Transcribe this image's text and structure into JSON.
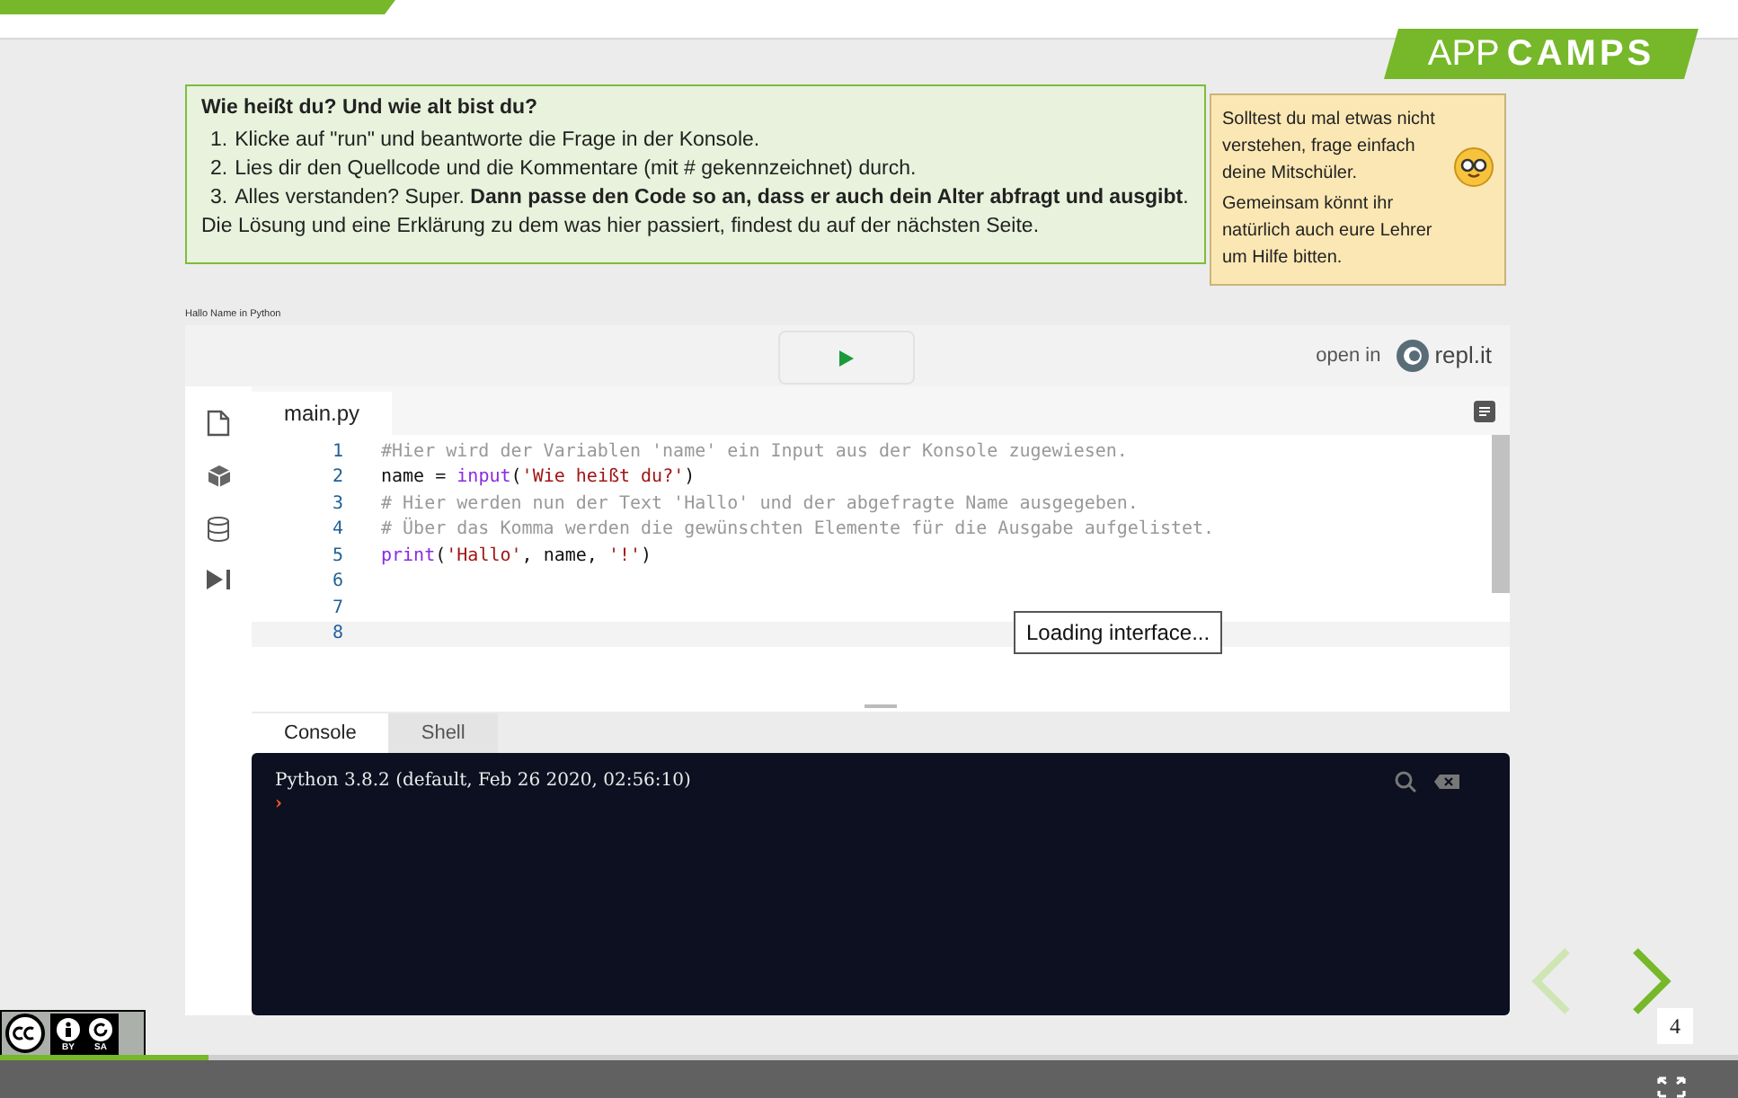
{
  "logo": {
    "word_1": "APP",
    "word_2": "CAMPS"
  },
  "instructions": {
    "title": "Wie heißt du? Und wie alt bist du?",
    "steps": [
      {
        "number": "1.",
        "text": "Klicke auf \"run\" und beantworte die Frage in der Konsole."
      },
      {
        "number": "2.",
        "text": "Lies dir den Quellcode und die Kommentare (mit # gekennzeichnet) durch."
      },
      {
        "number": "3.",
        "text": "Alles verstanden? Super. **Dann passe den Code so an, dass er auch dein Alter abfragt und ausgibt**."
      }
    ],
    "footer": "Die Lösung und eine Erklärung zu dem was hier passiert, findest du auf der nächsten Seite."
  },
  "tip": {
    "paragraphs": [
      "Solltest du mal etwas nicht verstehen, frage einfach deine Mitschüler.",
      "Gemeinsam könnt ihr natürlich auch eure Lehrer um Hilfe bitten."
    ]
  },
  "embed": {
    "caption": "Hallo Name in Python",
    "open_in": "open in",
    "brand": "repl.it",
    "file_tab": "main.py",
    "code_lines": [
      {
        "number": "1",
        "active": false,
        "tokens": [
          {
            "kind": "comment",
            "text": "#Hier wird der Variablen 'name' ein Input aus der Konsole zugewiesen."
          }
        ]
      },
      {
        "number": "2",
        "active": false,
        "tokens": [
          {
            "kind": "plain",
            "text": "name = "
          },
          {
            "kind": "builtin",
            "text": "input"
          },
          {
            "kind": "plain",
            "text": "("
          },
          {
            "kind": "string",
            "text": "'Wie heißt du?'"
          },
          {
            "kind": "plain",
            "text": ")"
          }
        ]
      },
      {
        "number": "3",
        "active": false,
        "tokens": [
          {
            "kind": "comment",
            "text": "# Hier werden nun der Text 'Hallo' und der abgefragte Name ausgegeben."
          }
        ]
      },
      {
        "number": "4",
        "active": false,
        "tokens": [
          {
            "kind": "comment",
            "text": "# Über das Komma werden die gewünschten Elemente für die Ausgabe aufgelistet."
          }
        ]
      },
      {
        "number": "5",
        "active": false,
        "tokens": [
          {
            "kind": "builtin",
            "text": "print"
          },
          {
            "kind": "plain",
            "text": "("
          },
          {
            "kind": "string",
            "text": "'Hallo'"
          },
          {
            "kind": "plain",
            "text": ", name, "
          },
          {
            "kind": "string",
            "text": "'!'"
          },
          {
            "kind": "plain",
            "text": ")"
          }
        ]
      },
      {
        "number": "6",
        "active": false
      },
      {
        "number": "7",
        "active": false
      },
      {
        "number": "8",
        "active": true
      }
    ],
    "tooltip": "Loading interface...",
    "console_tabs": [
      {
        "label": "Console",
        "selected": true
      },
      {
        "label": "Shell",
        "selected": false
      }
    ],
    "console_lines": [
      "Python 3.8.2 (default, Feb 26 2020, 02:56:10)"
    ],
    "prompt": "›"
  },
  "navigation": {
    "previous": {
      "disabled": true
    },
    "next": {
      "disabled": false
    }
  },
  "page_number": "4",
  "license": {
    "labels": [
      "BY",
      "SA"
    ]
  },
  "progress": {
    "level": 0.12
  }
}
